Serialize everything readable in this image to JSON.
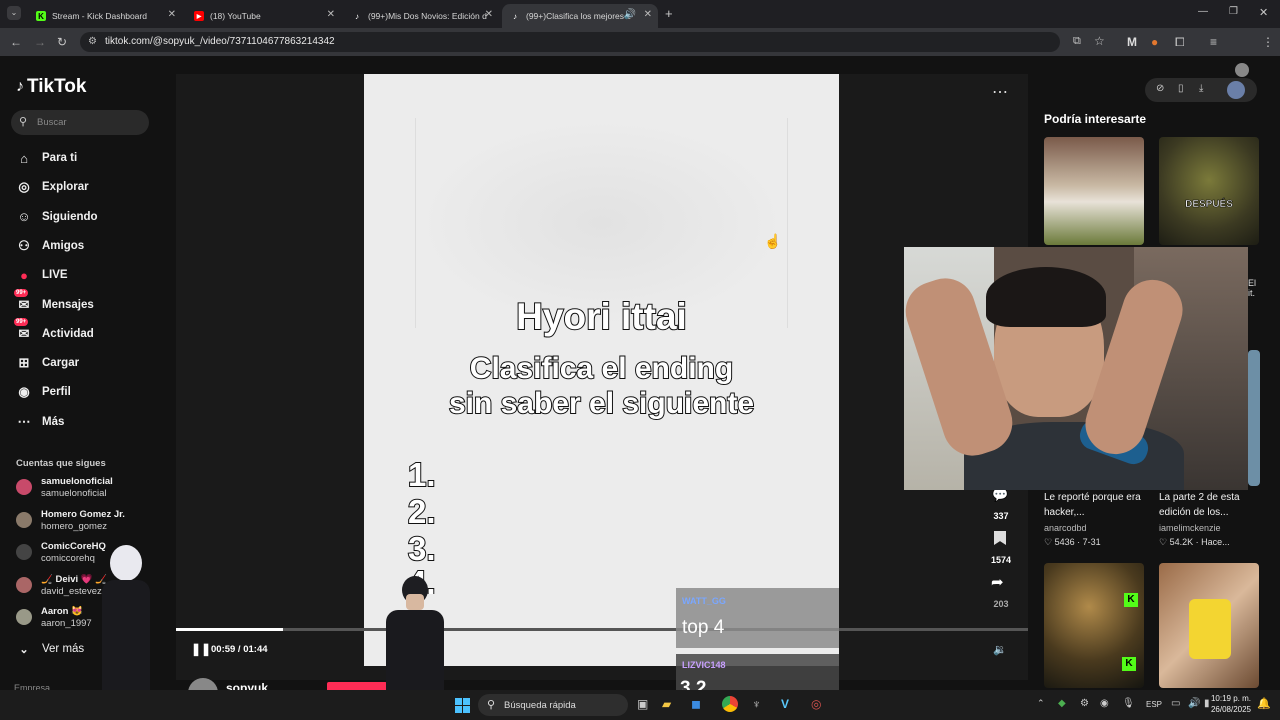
{
  "browser": {
    "tabs": [
      {
        "title": "Stream - Kick Dashboard",
        "icon": "kick-icon",
        "color": "#53fc18"
      },
      {
        "title": "(18) YouTube",
        "icon": "youtube-icon",
        "color": "#ff0000"
      },
      {
        "title": "(99+)Mis Dos Novios: Edición d",
        "icon": "tiktok-icon",
        "color": "#ffffff"
      },
      {
        "title": "(99+)Clasifica los mejores e",
        "icon": "tiktok-icon",
        "color": "#ffffff"
      }
    ],
    "url": "tiktok.com/@sopyuk_/video/7371104677863214342"
  },
  "sidebar": {
    "logo": "TikTok",
    "search_placeholder": "Buscar",
    "nav": [
      {
        "label": "Para ti",
        "icon": "home-icon"
      },
      {
        "label": "Explorar",
        "icon": "compass-icon"
      },
      {
        "label": "Siguiendo",
        "icon": "following-icon"
      },
      {
        "label": "Amigos",
        "icon": "friends-icon"
      },
      {
        "label": "LIVE",
        "icon": "live-icon"
      },
      {
        "label": "Mensajes",
        "icon": "messages-icon",
        "badge": "99+"
      },
      {
        "label": "Actividad",
        "icon": "activity-icon",
        "badge": "99+"
      },
      {
        "label": "Cargar",
        "icon": "upload-icon"
      },
      {
        "label": "Perfil",
        "icon": "profile-icon"
      },
      {
        "label": "Más",
        "icon": "more-icon"
      }
    ],
    "following_heading": "Cuentas que sigues",
    "following": [
      {
        "name": "samuelonoficial",
        "handle": "samuelonoficial"
      },
      {
        "name": "Homero Gomez Jr.",
        "handle": "homero_gomez"
      },
      {
        "name": "ComicCoreHQ",
        "handle": "comiccorehq"
      },
      {
        "name": "🏒 Deivi 💗 🏒",
        "handle": "david_estevez"
      },
      {
        "name": "Aaron 😻",
        "handle": "aaron_1997"
      }
    ],
    "see_more": "Ver más",
    "footer_label": "Empresa"
  },
  "video": {
    "title": "Hyori ittai",
    "caption_line1": "Clasifica el ending",
    "caption_line2": "sin saber el siguiente",
    "ranks": [
      "1.",
      "2.",
      "3.",
      "4."
    ],
    "time": "00:59 / 01:44",
    "progress": 0.567,
    "author": "sopyuk_",
    "comments": "337",
    "saves": "1574",
    "shares": "203"
  },
  "chat": {
    "user1": "WATT_GG",
    "msg1": "top 4",
    "user2": "LIZVIC148",
    "msg2": "3,2"
  },
  "suggest": {
    "heading": "Podría interesarte",
    "card1_overlay": "DESPUÉS",
    "card3_title": "Le reporté porque era hacker,...",
    "card3_author": "anarcodbd",
    "card3_stats": "♡ 5436 · 7-31",
    "card4_title": "La parte 2 de esta edición de los...",
    "card4_author": "iamelimckenzie",
    "card4_stats": "♡ 54.2K · Hace..."
  },
  "taskbar": {
    "search": "Búsqueda rápida",
    "lang": "ESP",
    "time": "10:19 p. m.",
    "date": "26/08/2025"
  }
}
